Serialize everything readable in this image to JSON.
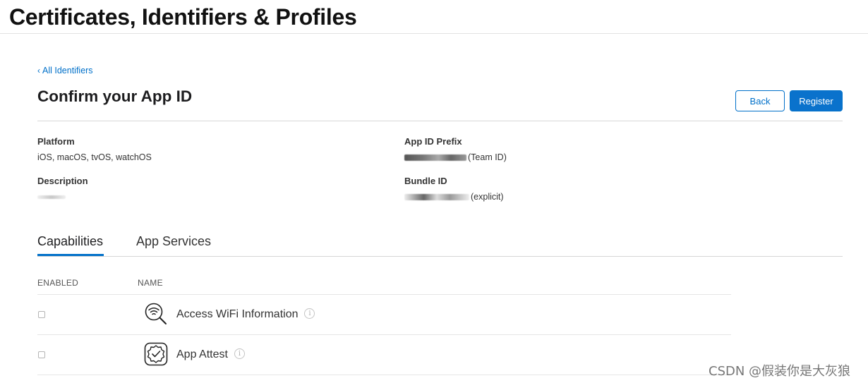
{
  "header": {
    "title": "Certificates, Identifiers & Profiles"
  },
  "nav": {
    "back_link": "All Identifiers",
    "back_icon": "chevron-left-icon"
  },
  "section": {
    "title": "Confirm your App ID"
  },
  "buttons": {
    "back": "Back",
    "register": "Register"
  },
  "details": {
    "platform": {
      "label": "Platform",
      "value": "iOS, macOS, tvOS, watchOS"
    },
    "description": {
      "label": "Description",
      "value": ""
    },
    "app_id_prefix": {
      "label": "App ID Prefix",
      "suffix": "(Team ID)"
    },
    "bundle_id": {
      "label": "Bundle ID",
      "suffix": "(explicit)"
    }
  },
  "tabs": [
    {
      "label": "Capabilities",
      "active": true
    },
    {
      "label": "App Services",
      "active": false
    }
  ],
  "table": {
    "columns": [
      "ENABLED",
      "NAME"
    ],
    "rows": [
      {
        "enabled": false,
        "name": "Access WiFi Information",
        "icon": "wifi-search-icon"
      },
      {
        "enabled": false,
        "name": "App Attest",
        "icon": "app-attest-badge-icon"
      }
    ]
  },
  "watermark": "CSDN @假装你是大灰狼",
  "colors": {
    "accent": "#0070c9",
    "text": "#1d1d1f",
    "divider": "#d6d6d6"
  }
}
